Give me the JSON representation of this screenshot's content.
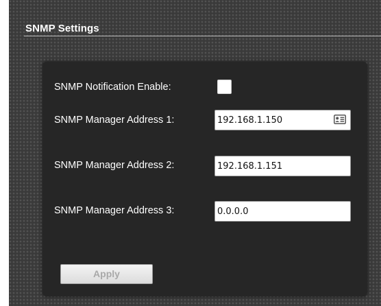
{
  "section": {
    "title": "SNMP Settings"
  },
  "form": {
    "notification_label": "SNMP Notification Enable:",
    "notification_checked": false,
    "manager1_label": "SNMP Manager Address 1:",
    "manager1_value": "192.168.1.150",
    "manager1_icon": "contact-card-icon",
    "manager2_label": "SNMP Manager Address 2:",
    "manager2_value": "192.168.1.151",
    "manager3_label": "SNMP Manager Address 3:",
    "manager3_value": "0.0.0.0"
  },
  "actions": {
    "apply_label": "Apply",
    "apply_enabled": false
  },
  "colors": {
    "background_pattern": "#3a3a3a",
    "panel": "#262626",
    "text": "#ffffff",
    "button_text_disabled": "#a9a9a9"
  }
}
